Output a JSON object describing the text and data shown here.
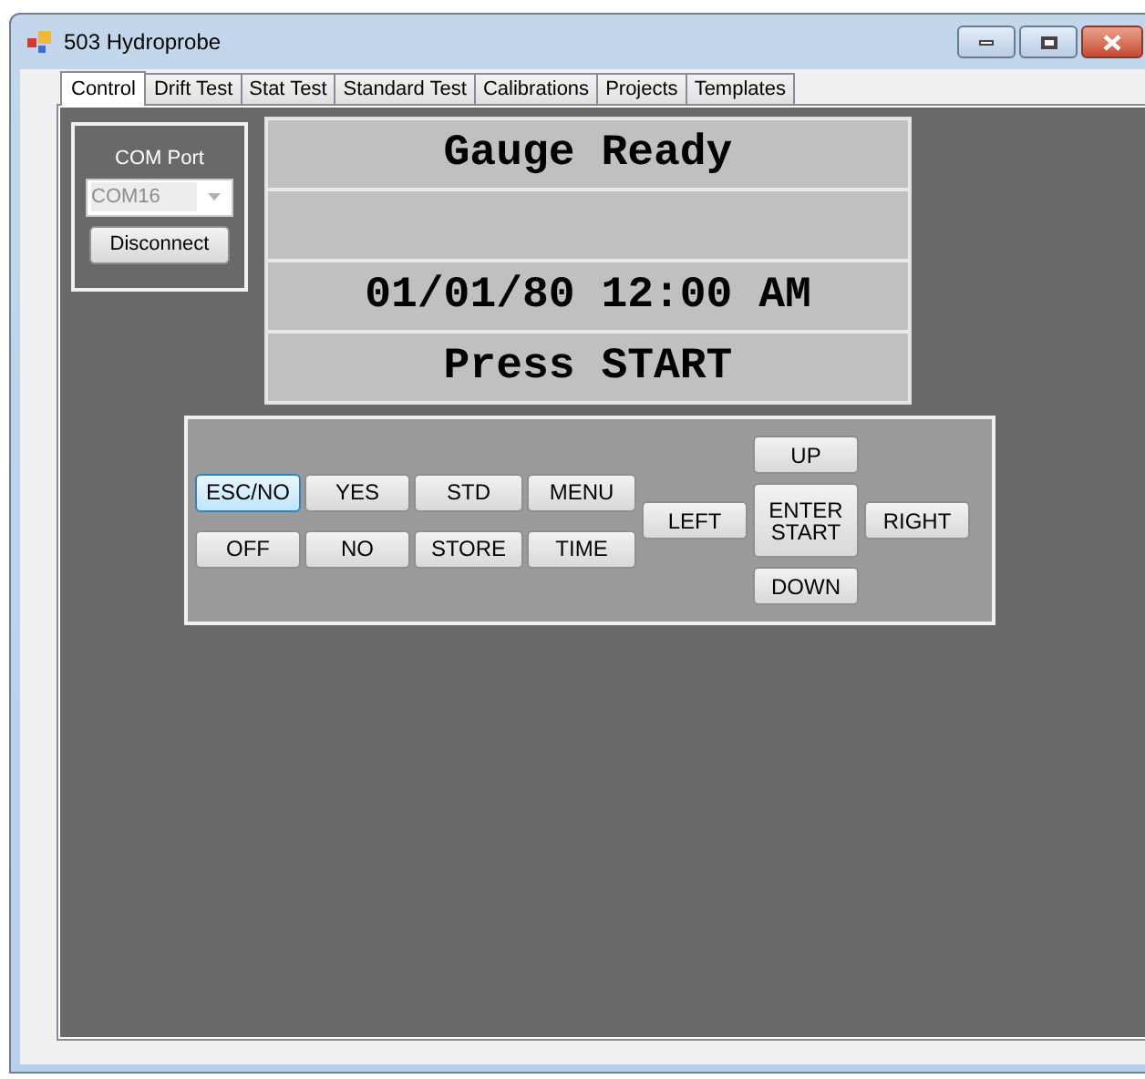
{
  "window": {
    "title": "503 Hydroprobe"
  },
  "tabs": [
    {
      "label": "Control",
      "selected": true
    },
    {
      "label": "Drift Test",
      "selected": false
    },
    {
      "label": "Stat Test",
      "selected": false
    },
    {
      "label": "Standard Test",
      "selected": false
    },
    {
      "label": "Calibrations",
      "selected": false
    },
    {
      "label": "Projects",
      "selected": false
    },
    {
      "label": "Templates",
      "selected": false
    }
  ],
  "com_port": {
    "label": "COM Port",
    "value": "COM16",
    "disabled": true,
    "button": "Disconnect"
  },
  "display": {
    "lines": [
      {
        "kind": "text",
        "text": "Gauge Ready"
      },
      {
        "kind": "blank"
      },
      {
        "kind": "text",
        "text": "01/01/80 12:00 AM"
      },
      {
        "kind": "text",
        "text": "Press START"
      }
    ]
  },
  "keypad": {
    "rows": [
      [
        {
          "label": "ESC/NO",
          "selected": true
        },
        {
          "label": "YES",
          "selected": false
        },
        {
          "label": "STD",
          "selected": false
        },
        {
          "label": "MENU",
          "selected": false
        }
      ],
      [
        {
          "label": "OFF",
          "selected": false
        },
        {
          "label": "NO",
          "selected": false
        },
        {
          "label": "STORE",
          "selected": false
        },
        {
          "label": "TIME",
          "selected": false
        }
      ]
    ],
    "left": {
      "label": "LEFT",
      "selected": false
    },
    "up": {
      "label": "UP",
      "selected": false
    },
    "enter": {
      "label": "ENTER START",
      "selected": false
    },
    "down": {
      "label": "DOWN",
      "selected": false
    },
    "right": {
      "label": "RIGHT",
      "selected": false
    }
  }
}
